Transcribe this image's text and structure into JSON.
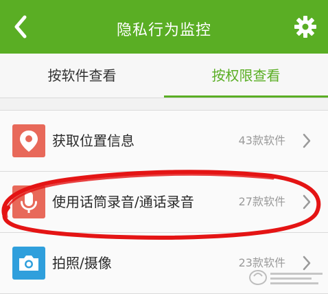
{
  "header": {
    "title": "隐私行为监控",
    "background_color": "#5aae24",
    "back_icon": "chevron-left-icon",
    "settings_icon": "gear-icon"
  },
  "tabs": [
    {
      "label": "按软件查看",
      "selected": false
    },
    {
      "label": "按权限查看",
      "selected": true
    }
  ],
  "permissions": [
    {
      "label": "获取位置信息",
      "count": "43款软件",
      "icon": "location-pin-icon",
      "icon_color": "#e8695a"
    },
    {
      "label": "使用话筒录音/通话录音",
      "count": "27款软件",
      "icon": "microphone-icon",
      "icon_color": "#e8695a"
    },
    {
      "label": "拍照/摄像",
      "count": "23款软件",
      "icon": "camera-icon",
      "icon_color": "#2f9fdc"
    }
  ],
  "accent_color": "#5aae24",
  "annotation_color": "#e41414"
}
